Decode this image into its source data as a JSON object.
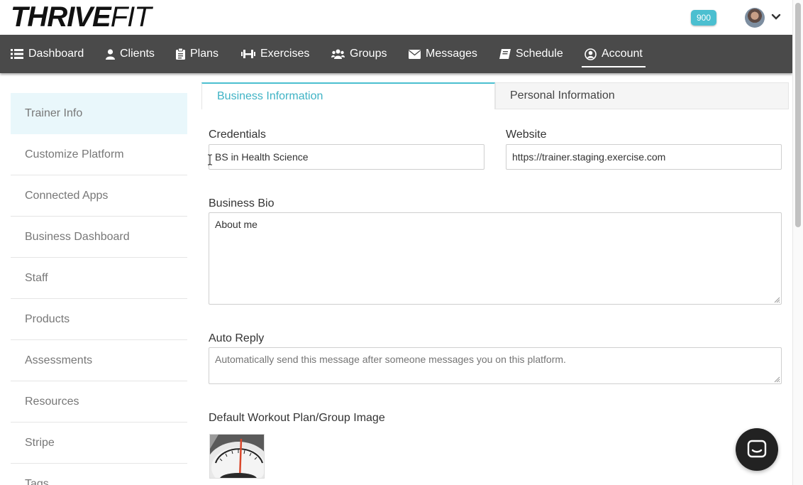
{
  "brand": {
    "logo_bold": "THRIVE",
    "logo_light": "FIT"
  },
  "header": {
    "points": "900"
  },
  "nav": {
    "items": [
      {
        "label": "Dashboard",
        "icon": "list-icon"
      },
      {
        "label": "Clients",
        "icon": "user-icon"
      },
      {
        "label": "Plans",
        "icon": "clipboard-icon"
      },
      {
        "label": "Exercises",
        "icon": "dumbbell-icon"
      },
      {
        "label": "Groups",
        "icon": "users-icon"
      },
      {
        "label": "Messages",
        "icon": "envelope-icon"
      },
      {
        "label": "Schedule",
        "icon": "book-icon"
      },
      {
        "label": "Account",
        "icon": "user-circle-icon"
      }
    ],
    "active": "Account"
  },
  "sidebar": {
    "items": [
      {
        "label": "Trainer Info"
      },
      {
        "label": "Customize Platform"
      },
      {
        "label": "Connected Apps"
      },
      {
        "label": "Business Dashboard"
      },
      {
        "label": "Staff"
      },
      {
        "label": "Products"
      },
      {
        "label": "Assessments"
      },
      {
        "label": "Resources"
      },
      {
        "label": "Stripe"
      },
      {
        "label": "Tags"
      }
    ],
    "active": "Trainer Info"
  },
  "tabs": {
    "business": "Business Information",
    "personal": "Personal Information",
    "active": "Business Information"
  },
  "form": {
    "credentials_label": "Credentials",
    "credentials_value": "BS in Health Science",
    "website_label": "Website",
    "website_value": "https://trainer.staging.exercise.com",
    "bio_label": "Business Bio",
    "bio_value": "About me",
    "auto_reply_label": "Auto Reply",
    "auto_reply_placeholder": "Automatically send this message after someone messages you on this platform.",
    "image_label": "Default Workout Plan/Group Image"
  },
  "colors": {
    "accent": "#4bbfd0",
    "nav_bg": "#4a4a4a",
    "sidebar_active_bg": "#e9f7fb"
  }
}
